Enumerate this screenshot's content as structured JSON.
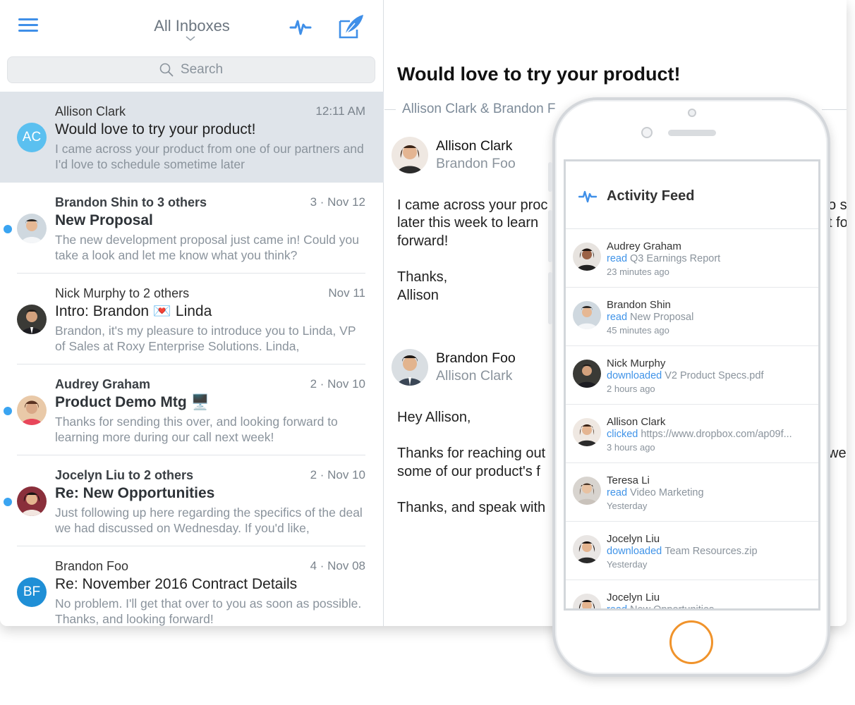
{
  "header": {
    "title": "All Inboxes",
    "search_placeholder": "Search"
  },
  "messages": [
    {
      "from": "Allison Clark",
      "date": "12:11 AM",
      "subject": "Would love to try your product!",
      "preview": "I came across your product from one of our partners and I'd love to schedule sometime later",
      "initials": "AC",
      "avatar_color": "#5bc0f0",
      "unread": false,
      "selected": true
    },
    {
      "from": "Brandon Shin to 3 others",
      "date": "3 · Nov 12",
      "subject": "New Proposal",
      "preview": "The new development proposal just came in! Could you take a look and let me know what you think?",
      "unread": true,
      "selected": false
    },
    {
      "from": "Nick Murphy to 2 others",
      "date": "Nov 11",
      "subject": "Intro: Brandon 💌 Linda",
      "preview": "Brandon, it's my pleasure to introduce you to Linda, VP of Sales at Roxy Enterprise Solutions. Linda,",
      "unread": false,
      "selected": false
    },
    {
      "from": "Audrey Graham",
      "date": "2 · Nov 10",
      "subject": "Product Demo Mtg 🖥️",
      "preview": "Thanks for sending this over, and looking forward to learning more during our call next week!",
      "unread": true,
      "selected": false
    },
    {
      "from": "Jocelyn Liu to 2 others",
      "date": "2 · Nov 10",
      "subject": "Re: New Opportunities",
      "preview": "Just following up here regarding the specifics of the deal we had discussed on Wednesday. If you'd like,",
      "unread": true,
      "selected": false
    },
    {
      "from": "Brandon Foo",
      "date": "4 · Nov 08",
      "subject": "Re: November 2016 Contract Details",
      "preview": "No problem. I'll get that over to you as soon as possible. Thanks, and looking forward!",
      "initials": "BF",
      "avatar_color": "#1f8fd6",
      "unread": false,
      "selected": false
    }
  ],
  "reader": {
    "subject": "Would love to try your product!",
    "participants": "Allison Clark & Brandon F",
    "message1": {
      "from": "Allison Clark",
      "to": "Brandon Foo",
      "lines": [
        "I came across your proc",
        "later this week to learn",
        "forward!",
        "Thanks,",
        "Allison"
      ]
    },
    "message2": {
      "from": "Brandon Foo",
      "to": "Allison Clark",
      "lines": [
        "Hey Allison,",
        "Thanks for reaching out",
        "some of our product's f",
        "Thanks, and speak with"
      ]
    },
    "overflow_right": [
      "o s",
      "t fo",
      "we"
    ]
  },
  "activity_feed": {
    "title": "Activity Feed",
    "items": [
      {
        "name": "Audrey Graham",
        "verb": "read",
        "object": "Q3 Earnings Report",
        "time": "23 minutes ago"
      },
      {
        "name": "Brandon Shin",
        "verb": "read",
        "object": "New Proposal",
        "time": "45 minutes ago"
      },
      {
        "name": "Nick Murphy",
        "verb": "downloaded",
        "object": "V2 Product Specs.pdf",
        "time": "2 hours ago"
      },
      {
        "name": "Allison Clark",
        "verb": "clicked",
        "object": "https://www.dropbox.com/ap09f...",
        "time": "3 hours ago"
      },
      {
        "name": "Teresa Li",
        "verb": "read",
        "object": "Video Marketing",
        "time": "Yesterday"
      },
      {
        "name": "Jocelyn Liu",
        "verb": "downloaded",
        "object": "Team Resources.zip",
        "time": "Yesterday"
      },
      {
        "name": "Jocelyn Liu",
        "verb": "read",
        "object": "New Opportunities",
        "time": ""
      }
    ]
  },
  "colors": {
    "accent": "#3f8fe8",
    "unread_dot": "#3aa4f1",
    "selected_bg": "#dfe4ea",
    "home_ring": "#f0932b"
  },
  "icons": {
    "menu": "hamburger-menu-icon",
    "activity": "pulse-icon",
    "compose": "compose-feather-icon",
    "search": "search-icon"
  }
}
